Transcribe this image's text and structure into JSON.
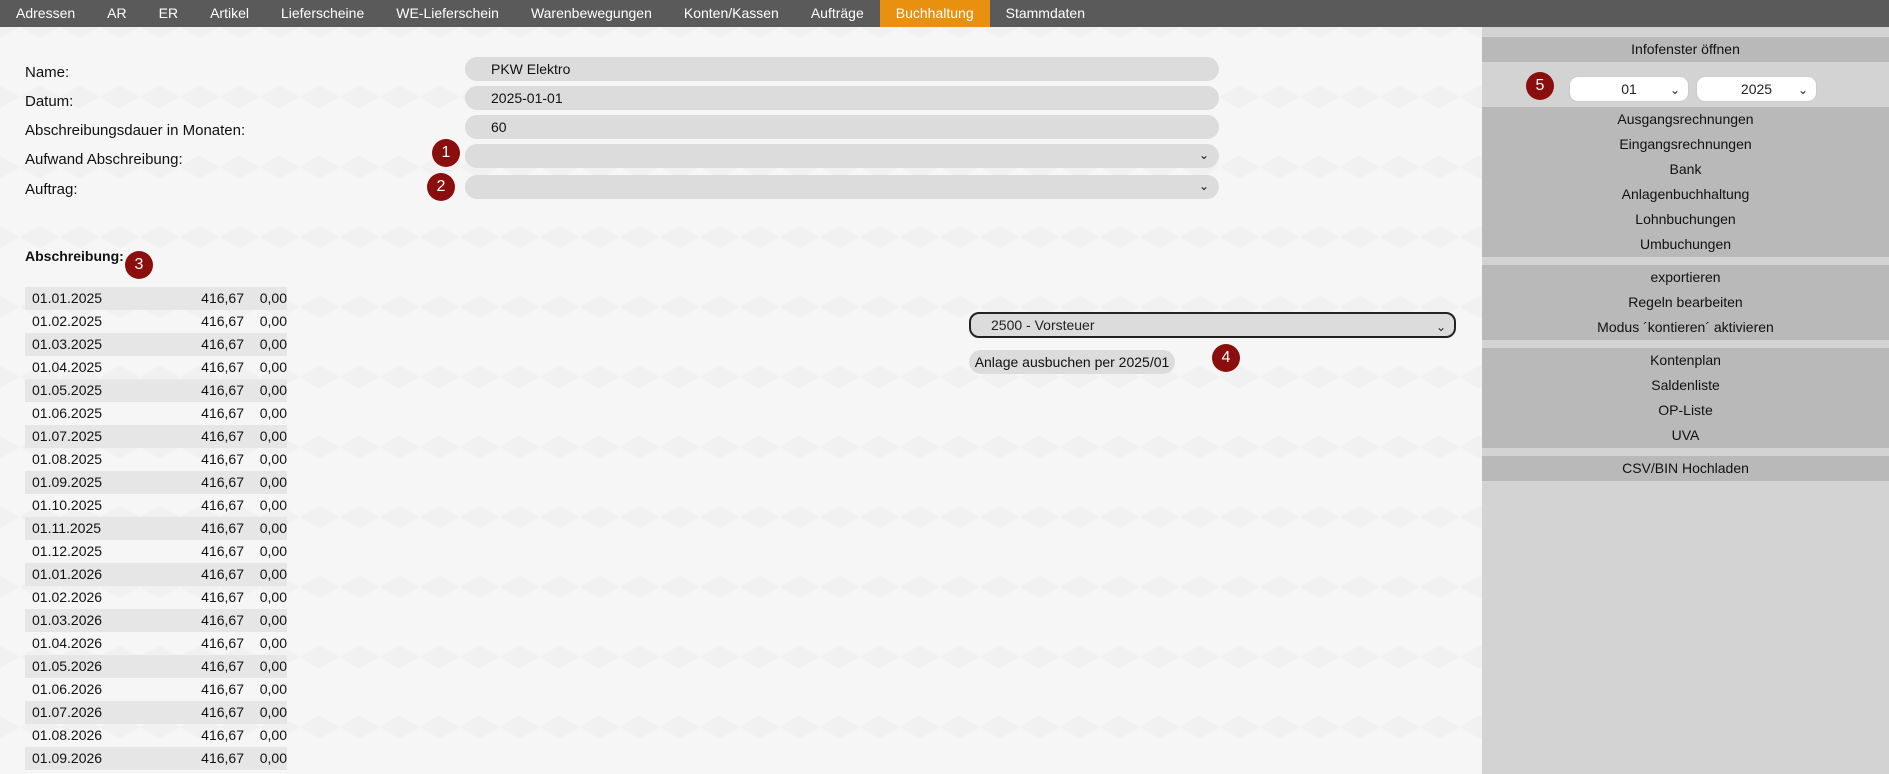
{
  "nav": {
    "items": [
      "Adressen",
      "AR",
      "ER",
      "Artikel",
      "Lieferscheine",
      "WE-Lieferschein",
      "Warenbewegungen",
      "Konten/Kassen",
      "Aufträge",
      "Buchhaltung",
      "Stammdaten"
    ],
    "active": "Buchhaltung"
  },
  "form": {
    "name_label": "Name:",
    "name_value": "PKW Elektro",
    "datum_label": "Datum:",
    "datum_value": "2025-01-01",
    "dauer_label": "Abschreibungsdauer in Monaten:",
    "dauer_value": "60",
    "aufwand_label": "Aufwand Abschreibung:",
    "aufwand_value": "",
    "auftrag_label": "Auftrag:",
    "auftrag_value": ""
  },
  "badges": [
    "1",
    "2",
    "3",
    "4",
    "5"
  ],
  "schedule": {
    "title": "Abschreibung:",
    "rows": [
      {
        "date": "01.01.2025",
        "amount": "416,67",
        "rest": "0,00"
      },
      {
        "date": "01.02.2025",
        "amount": "416,67",
        "rest": "0,00"
      },
      {
        "date": "01.03.2025",
        "amount": "416,67",
        "rest": "0,00"
      },
      {
        "date": "01.04.2025",
        "amount": "416,67",
        "rest": "0,00"
      },
      {
        "date": "01.05.2025",
        "amount": "416,67",
        "rest": "0,00"
      },
      {
        "date": "01.06.2025",
        "amount": "416,67",
        "rest": "0,00"
      },
      {
        "date": "01.07.2025",
        "amount": "416,67",
        "rest": "0,00"
      },
      {
        "date": "01.08.2025",
        "amount": "416,67",
        "rest": "0,00"
      },
      {
        "date": "01.09.2025",
        "amount": "416,67",
        "rest": "0,00"
      },
      {
        "date": "01.10.2025",
        "amount": "416,67",
        "rest": "0,00"
      },
      {
        "date": "01.11.2025",
        "amount": "416,67",
        "rest": "0,00"
      },
      {
        "date": "01.12.2025",
        "amount": "416,67",
        "rest": "0,00"
      },
      {
        "date": "01.01.2026",
        "amount": "416,67",
        "rest": "0,00"
      },
      {
        "date": "01.02.2026",
        "amount": "416,67",
        "rest": "0,00"
      },
      {
        "date": "01.03.2026",
        "amount": "416,67",
        "rest": "0,00"
      },
      {
        "date": "01.04.2026",
        "amount": "416,67",
        "rest": "0,00"
      },
      {
        "date": "01.05.2026",
        "amount": "416,67",
        "rest": "0,00"
      },
      {
        "date": "01.06.2026",
        "amount": "416,67",
        "rest": "0,00"
      },
      {
        "date": "01.07.2026",
        "amount": "416,67",
        "rest": "0,00"
      },
      {
        "date": "01.08.2026",
        "amount": "416,67",
        "rest": "0,00"
      },
      {
        "date": "01.09.2026",
        "amount": "416,67",
        "rest": "0,00"
      }
    ]
  },
  "booking": {
    "account_value": "2500 - Vorsteuer",
    "button_label": "Anlage ausbuchen per 2025/01"
  },
  "sidebar": {
    "infofenster": "Infofenster öffnen",
    "month_value": "01",
    "year_value": "2025",
    "group1": [
      "Ausgangsrechnungen",
      "Eingangsrechnungen",
      "Bank",
      "Anlagenbuchhaltung",
      "Lohnbuchungen",
      "Umbuchungen"
    ],
    "group2": [
      "exportieren",
      "Regeln bearbeiten",
      "Modus ´kontieren´ aktivieren"
    ],
    "group3": [
      "Kontenplan",
      "Saldenliste",
      "OP-Liste",
      "UVA"
    ],
    "upload": "CSV/BIN Hochladen"
  },
  "icons": {
    "dropdown": "chevron-down-icon",
    "chevron_glyph": "⌄"
  },
  "colors": {
    "nav_bg": "#5a5a5a",
    "nav_active": "#e8900f",
    "badge": "#8b0e0e",
    "sidebar_bg": "#d3d3d3",
    "sidebar_group": "#b9b9b9"
  }
}
